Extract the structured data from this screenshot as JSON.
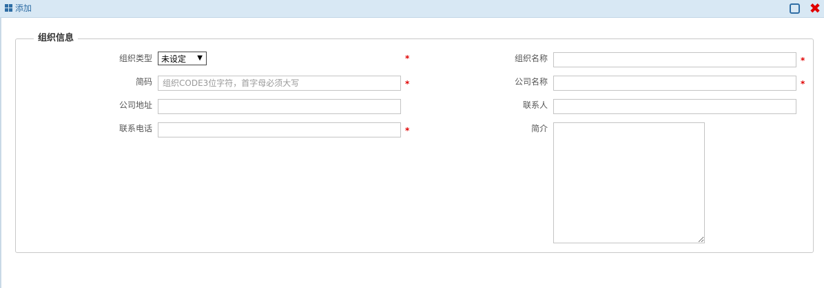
{
  "titlebar": {
    "title": "添加",
    "title_icon": "grid-icon",
    "maximize_icon": "maximize-icon",
    "close_icon": "close-icon",
    "close_glyph": "✖"
  },
  "form": {
    "legend": "组织信息",
    "required_mark": "*",
    "org_type": {
      "label": "组织类型",
      "value": "未设定",
      "arrow": "▼"
    },
    "org_name": {
      "label": "组织名称",
      "value": ""
    },
    "short_code": {
      "label": "简码",
      "placeholder": "组织CODE3位字符，首字母必须大写",
      "value": ""
    },
    "company_name": {
      "label": "公司名称",
      "value": ""
    },
    "company_address": {
      "label": "公司地址",
      "value": ""
    },
    "contact_person": {
      "label": "联系人",
      "value": ""
    },
    "contact_phone": {
      "label": "联系电话",
      "value": ""
    },
    "intro": {
      "label": "简介",
      "value": ""
    }
  },
  "colors": {
    "titlebar_bg": "#d8e8f4",
    "accent": "#2e6da4",
    "required": "#e00000"
  }
}
